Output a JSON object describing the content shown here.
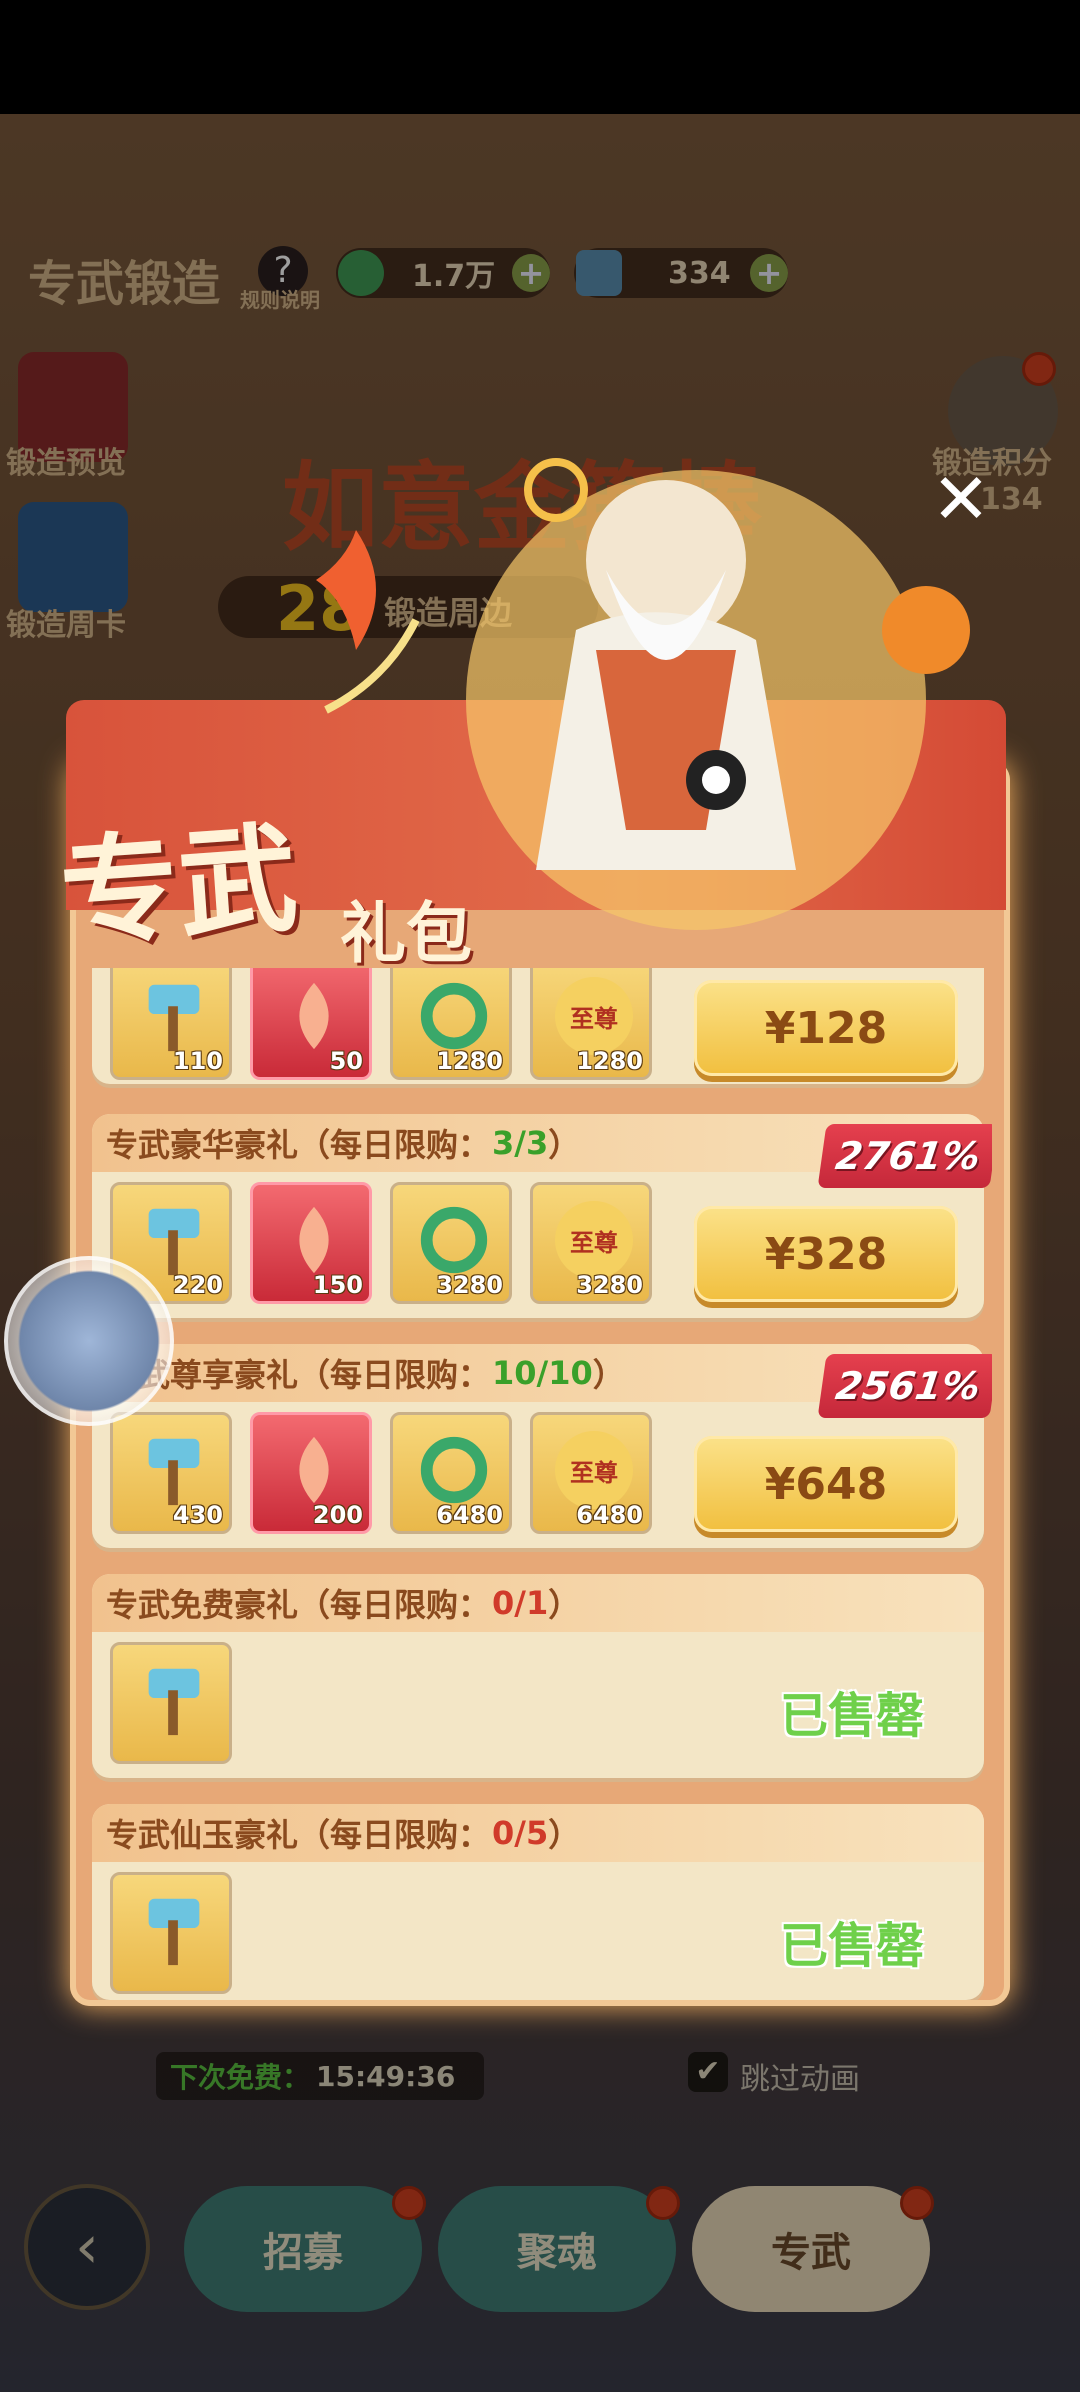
{
  "header": {
    "title": "专武锻造",
    "rules_label": "规则说明",
    "currency_jade": "1.7万",
    "currency_hammer": "334"
  },
  "side": {
    "forge_preview": "锻造预览",
    "forge_weekly_card": "锻造周卡",
    "forge_points": "锻造积分",
    "forge_points_value": "134"
  },
  "background": {
    "weapon_name": "如意金箍棒",
    "count": "28",
    "count_label": "锻造周边",
    "next_free_label": "下次免费：",
    "next_free_time": "15:49:36",
    "skip_animation": "跳过动画"
  },
  "popup": {
    "title_main": "专武",
    "title_sub": "礼包",
    "close": "✕",
    "cards": [
      {
        "title": "",
        "limit": "",
        "items": [
          {
            "qty": "110",
            "kind": "hammer"
          },
          {
            "qty": "50",
            "kind": "flame"
          },
          {
            "qty": "1280",
            "kind": "dragon"
          },
          {
            "qty": "1280",
            "kind": "supreme"
          }
        ],
        "price": "¥128"
      },
      {
        "title": "专武豪华豪礼（每日限购：",
        "limit": "3/3",
        "limit_color": "#3aa02a",
        "bonus": "2761%",
        "items": [
          {
            "qty": "220",
            "kind": "hammer"
          },
          {
            "qty": "150",
            "kind": "flame"
          },
          {
            "qty": "3280",
            "kind": "dragon"
          },
          {
            "qty": "3280",
            "kind": "supreme"
          }
        ],
        "price": "¥328"
      },
      {
        "title": "专武尊享豪礼（每日限购：",
        "limit": "10/10",
        "limit_color": "#3aa02a",
        "bonus": "2561%",
        "items": [
          {
            "qty": "430",
            "kind": "hammer"
          },
          {
            "qty": "200",
            "kind": "flame"
          },
          {
            "qty": "6480",
            "kind": "dragon"
          },
          {
            "qty": "6480",
            "kind": "supreme"
          }
        ],
        "price": "¥648"
      },
      {
        "title": "专武免费豪礼（每日限购：",
        "limit": "0/1",
        "limit_color": "#d03a2a",
        "items": [
          {
            "qty": "",
            "kind": "hammer"
          }
        ],
        "status": "已售罄"
      },
      {
        "title": "专武仙玉豪礼（每日限购：",
        "limit": "0/5",
        "limit_color": "#d03a2a",
        "items": [
          {
            "qty": "",
            "kind": "hammer"
          }
        ],
        "status": "已售罄"
      }
    ],
    "close_paren": "）",
    "supreme_text": "至尊"
  },
  "tabs": [
    {
      "label": "招募"
    },
    {
      "label": "聚魂"
    },
    {
      "label": "专武"
    }
  ],
  "colors": {
    "popup_bg": "#e7a877",
    "buy_button": "#f1bf3e",
    "soldout": "#6fd04a",
    "bonus_ribbon": "#c5283a"
  }
}
